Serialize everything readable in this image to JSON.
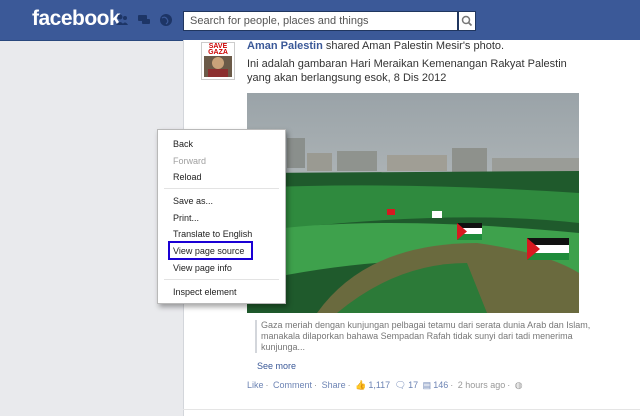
{
  "topbar": {
    "logo": "facebook",
    "search_placeholder": "Search for people, places and things"
  },
  "story": {
    "author": "Aman Palestin",
    "action_text": " shared Aman Palestin Mesir's photo.",
    "text": "Ini adalah gambaran Hari Meraikan Kemenangan Rakyat Palestin yang akan berlangsung esok, 8 Dis 2012",
    "avatar_text": "SAVE GAZA",
    "caption": "Gaza meriah dengan kunjungan pelbagai tetamu dari serata dunia Arab dan Islam, manakala dilaporkan bahawa Sempadan Rafah tidak sunyi dari tadi menerima kunjunga...",
    "see_more": "See more",
    "actions": {
      "like": "Like",
      "comment": "Comment",
      "share": "Share",
      "likes_count": "1,117",
      "comments_count": "17",
      "shares_count": "146",
      "time": "2 hours ago"
    }
  },
  "context_menu": {
    "items": [
      {
        "label": "Back",
        "enabled": true
      },
      {
        "label": "Forward",
        "enabled": false
      },
      {
        "label": "Reload",
        "enabled": true
      },
      {
        "label": "Save as...",
        "enabled": true
      },
      {
        "label": "Print...",
        "enabled": true
      },
      {
        "label": "Translate to English",
        "enabled": true
      },
      {
        "label": "View page source",
        "enabled": true,
        "highlighted": true
      },
      {
        "label": "View page info",
        "enabled": true
      },
      {
        "label": "Inspect element",
        "enabled": true
      }
    ],
    "highlight_color": "#1a00d4"
  },
  "colors": {
    "brand": "#3b5998",
    "link": "#3b5998",
    "page_bg": "#e9eaed"
  }
}
